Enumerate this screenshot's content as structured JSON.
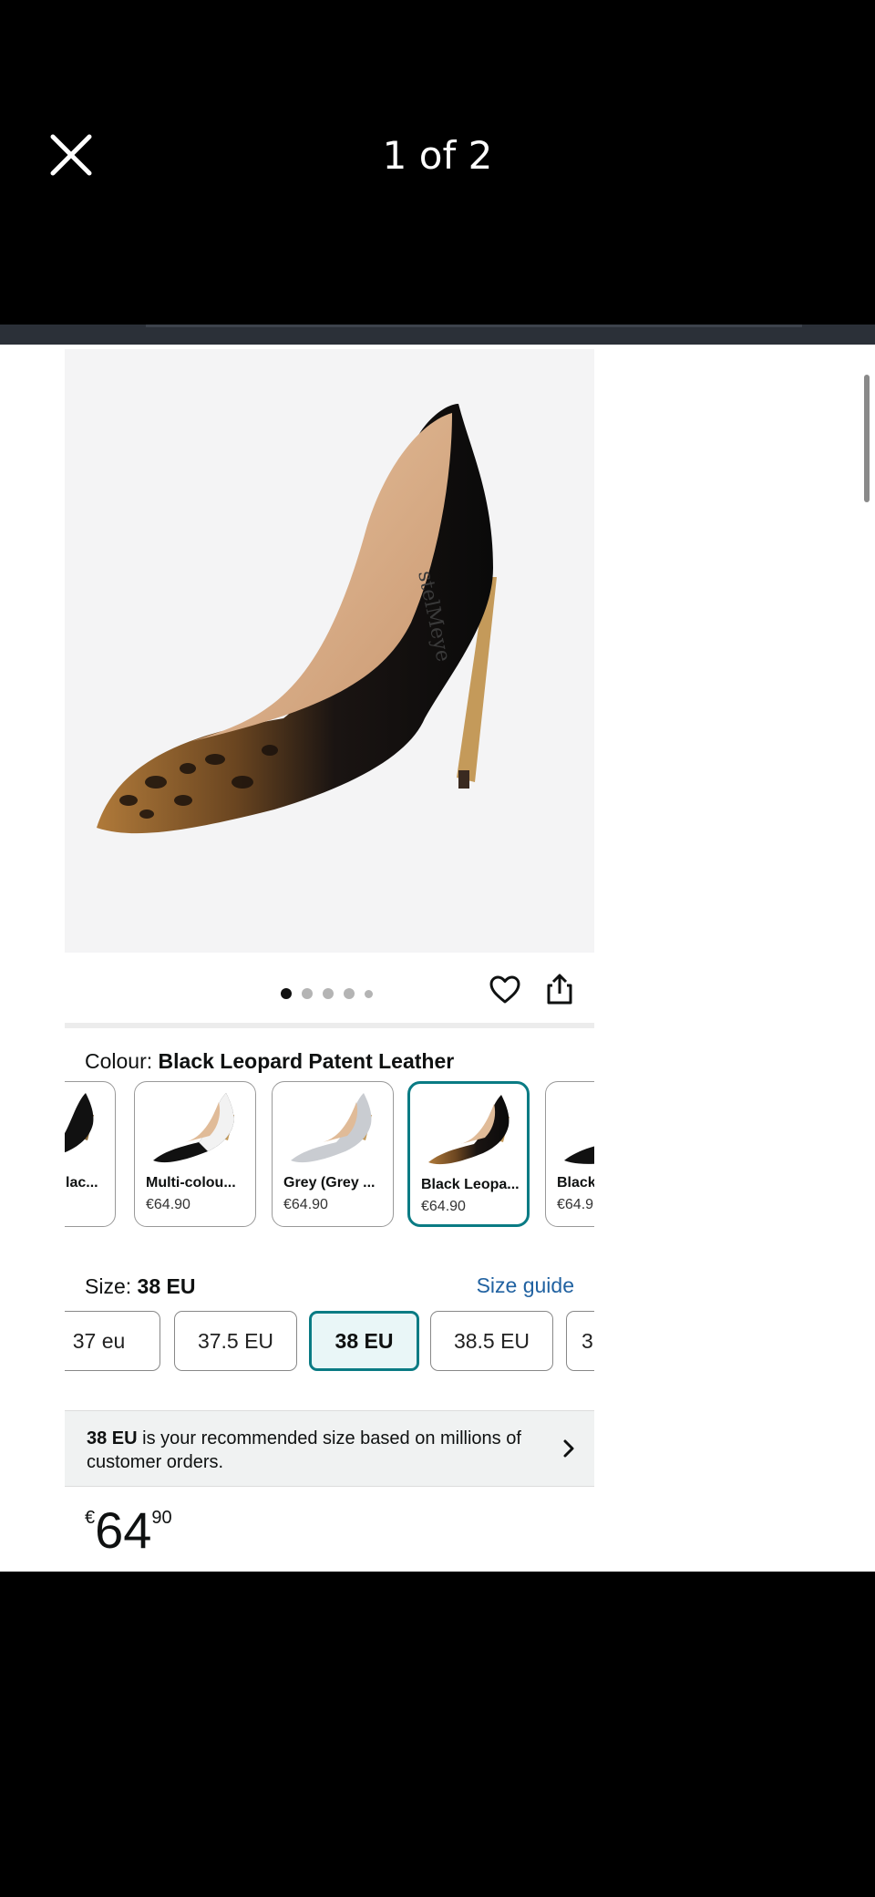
{
  "header": {
    "title": "1 of 2",
    "close_icon": "close-icon"
  },
  "gallery": {
    "dots_total": 5,
    "active_index": 0,
    "favorite_icon": "heart-icon",
    "share_icon": "share-icon"
  },
  "colour": {
    "label": "Colour:",
    "value": "Black Leopard Patent Leather",
    "options": [
      {
        "name": "lac...",
        "price": "",
        "selected": false
      },
      {
        "name": "Multi-colou...",
        "price": "€64.90",
        "selected": false
      },
      {
        "name": "Grey (Grey ...",
        "price": "€64.90",
        "selected": false
      },
      {
        "name": "Black Leopa...",
        "price": "€64.90",
        "selected": true
      },
      {
        "name": "Black",
        "price": "€64.9",
        "selected": false
      }
    ]
  },
  "size": {
    "label": "Size:",
    "value": "38 EU",
    "guide_label": "Size guide",
    "options": [
      {
        "label": "37 eu",
        "selected": false
      },
      {
        "label": "37.5 EU",
        "selected": false
      },
      {
        "label": "38 EU",
        "selected": true
      },
      {
        "label": "38.5 EU",
        "selected": false
      },
      {
        "label": "3",
        "selected": false
      }
    ]
  },
  "recommendation": {
    "size": "38 EU",
    "text": "is your recommended size based on millions of customer orders."
  },
  "price": {
    "currency": "€",
    "whole": "64",
    "fraction": "90"
  },
  "colors": {
    "accent": "#0a7b84",
    "link": "#2162a1"
  }
}
